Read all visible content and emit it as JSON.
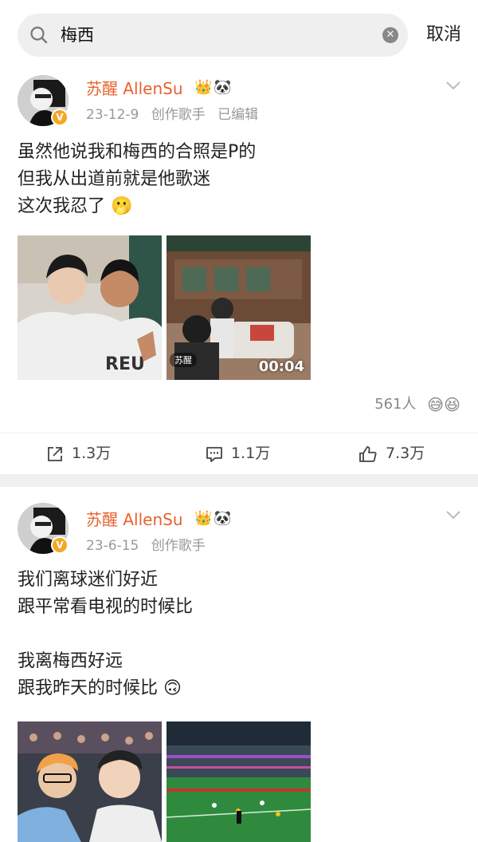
{
  "search": {
    "query": "梅西",
    "cancel_label": "取消"
  },
  "posts": [
    {
      "author": "苏醒 AllenSu",
      "author_icons": [
        "crown-icon",
        "panda-icon"
      ],
      "date": "23-12-9",
      "role": "创作歌手",
      "edited": "已编辑",
      "text": "虽然他说我和梅西的合照是P的\n但我从出道前就是他歌迷\n这次我忍了",
      "text_emoji": "🫢",
      "images": [
        {
          "kind": "photo",
          "alt": "selfie"
        },
        {
          "kind": "video",
          "duration": "00:04",
          "tag": "苏醒"
        }
      ],
      "reactions_count": "561人",
      "reactions_emoji": "😅😆",
      "actions": {
        "share": "1.3万",
        "comment": "1.1万",
        "like": "7.3万"
      }
    },
    {
      "author": "苏醒 AllenSu",
      "author_icons": [
        "crown-icon",
        "panda-icon"
      ],
      "date": "23-6-15",
      "role": "创作歌手",
      "text": "我们离球迷们好近\n跟平常看电视的时候比\n\n我离梅西好远\n跟我昨天的时候比",
      "text_emoji": "🙃",
      "images": [
        {
          "kind": "photo"
        },
        {
          "kind": "photo"
        }
      ]
    }
  ],
  "colors": {
    "name": "#e8622c",
    "meta": "#999999",
    "divider": "#f0f0f0"
  }
}
